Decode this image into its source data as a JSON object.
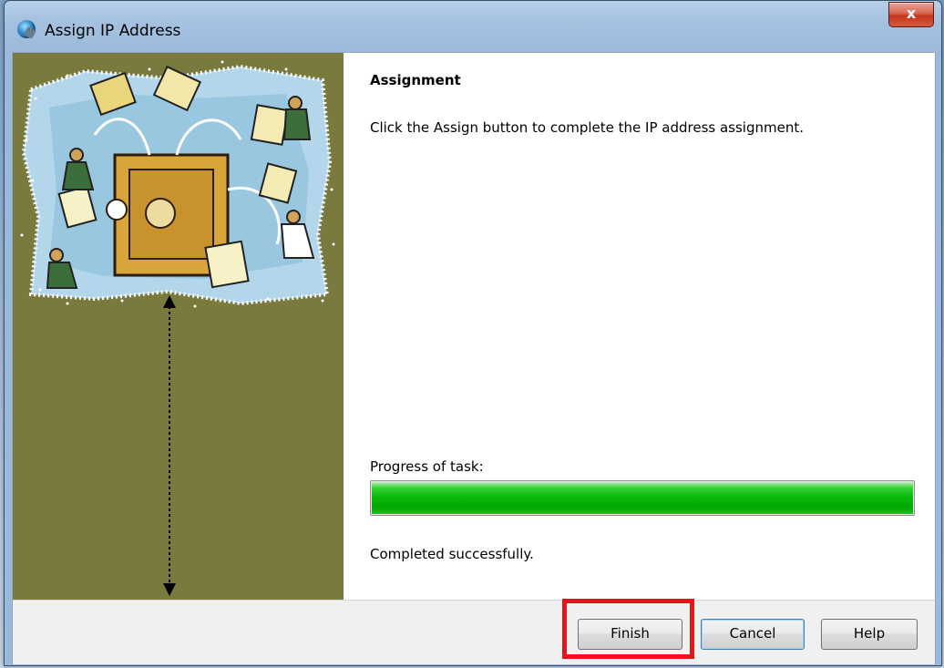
{
  "window": {
    "title": "Assign IP Address",
    "close_label": "x"
  },
  "content": {
    "heading": "Assignment",
    "instruction": "Click the Assign button to complete the IP address assignment.",
    "progress_label": "Progress of task:",
    "progress_percent": 100,
    "status": "Completed successfully."
  },
  "buttons": {
    "finish": "Finish",
    "cancel": "Cancel",
    "help": "Help"
  },
  "colors": {
    "side_panel": "#7a7a3e",
    "progress_green": "#06b806",
    "highlight_red": "#e8141c"
  },
  "icons": {
    "app_icon": "globe-network-icon",
    "illustration": "wizard-illustration",
    "arrow": "double-arrow-vertical-icon"
  }
}
